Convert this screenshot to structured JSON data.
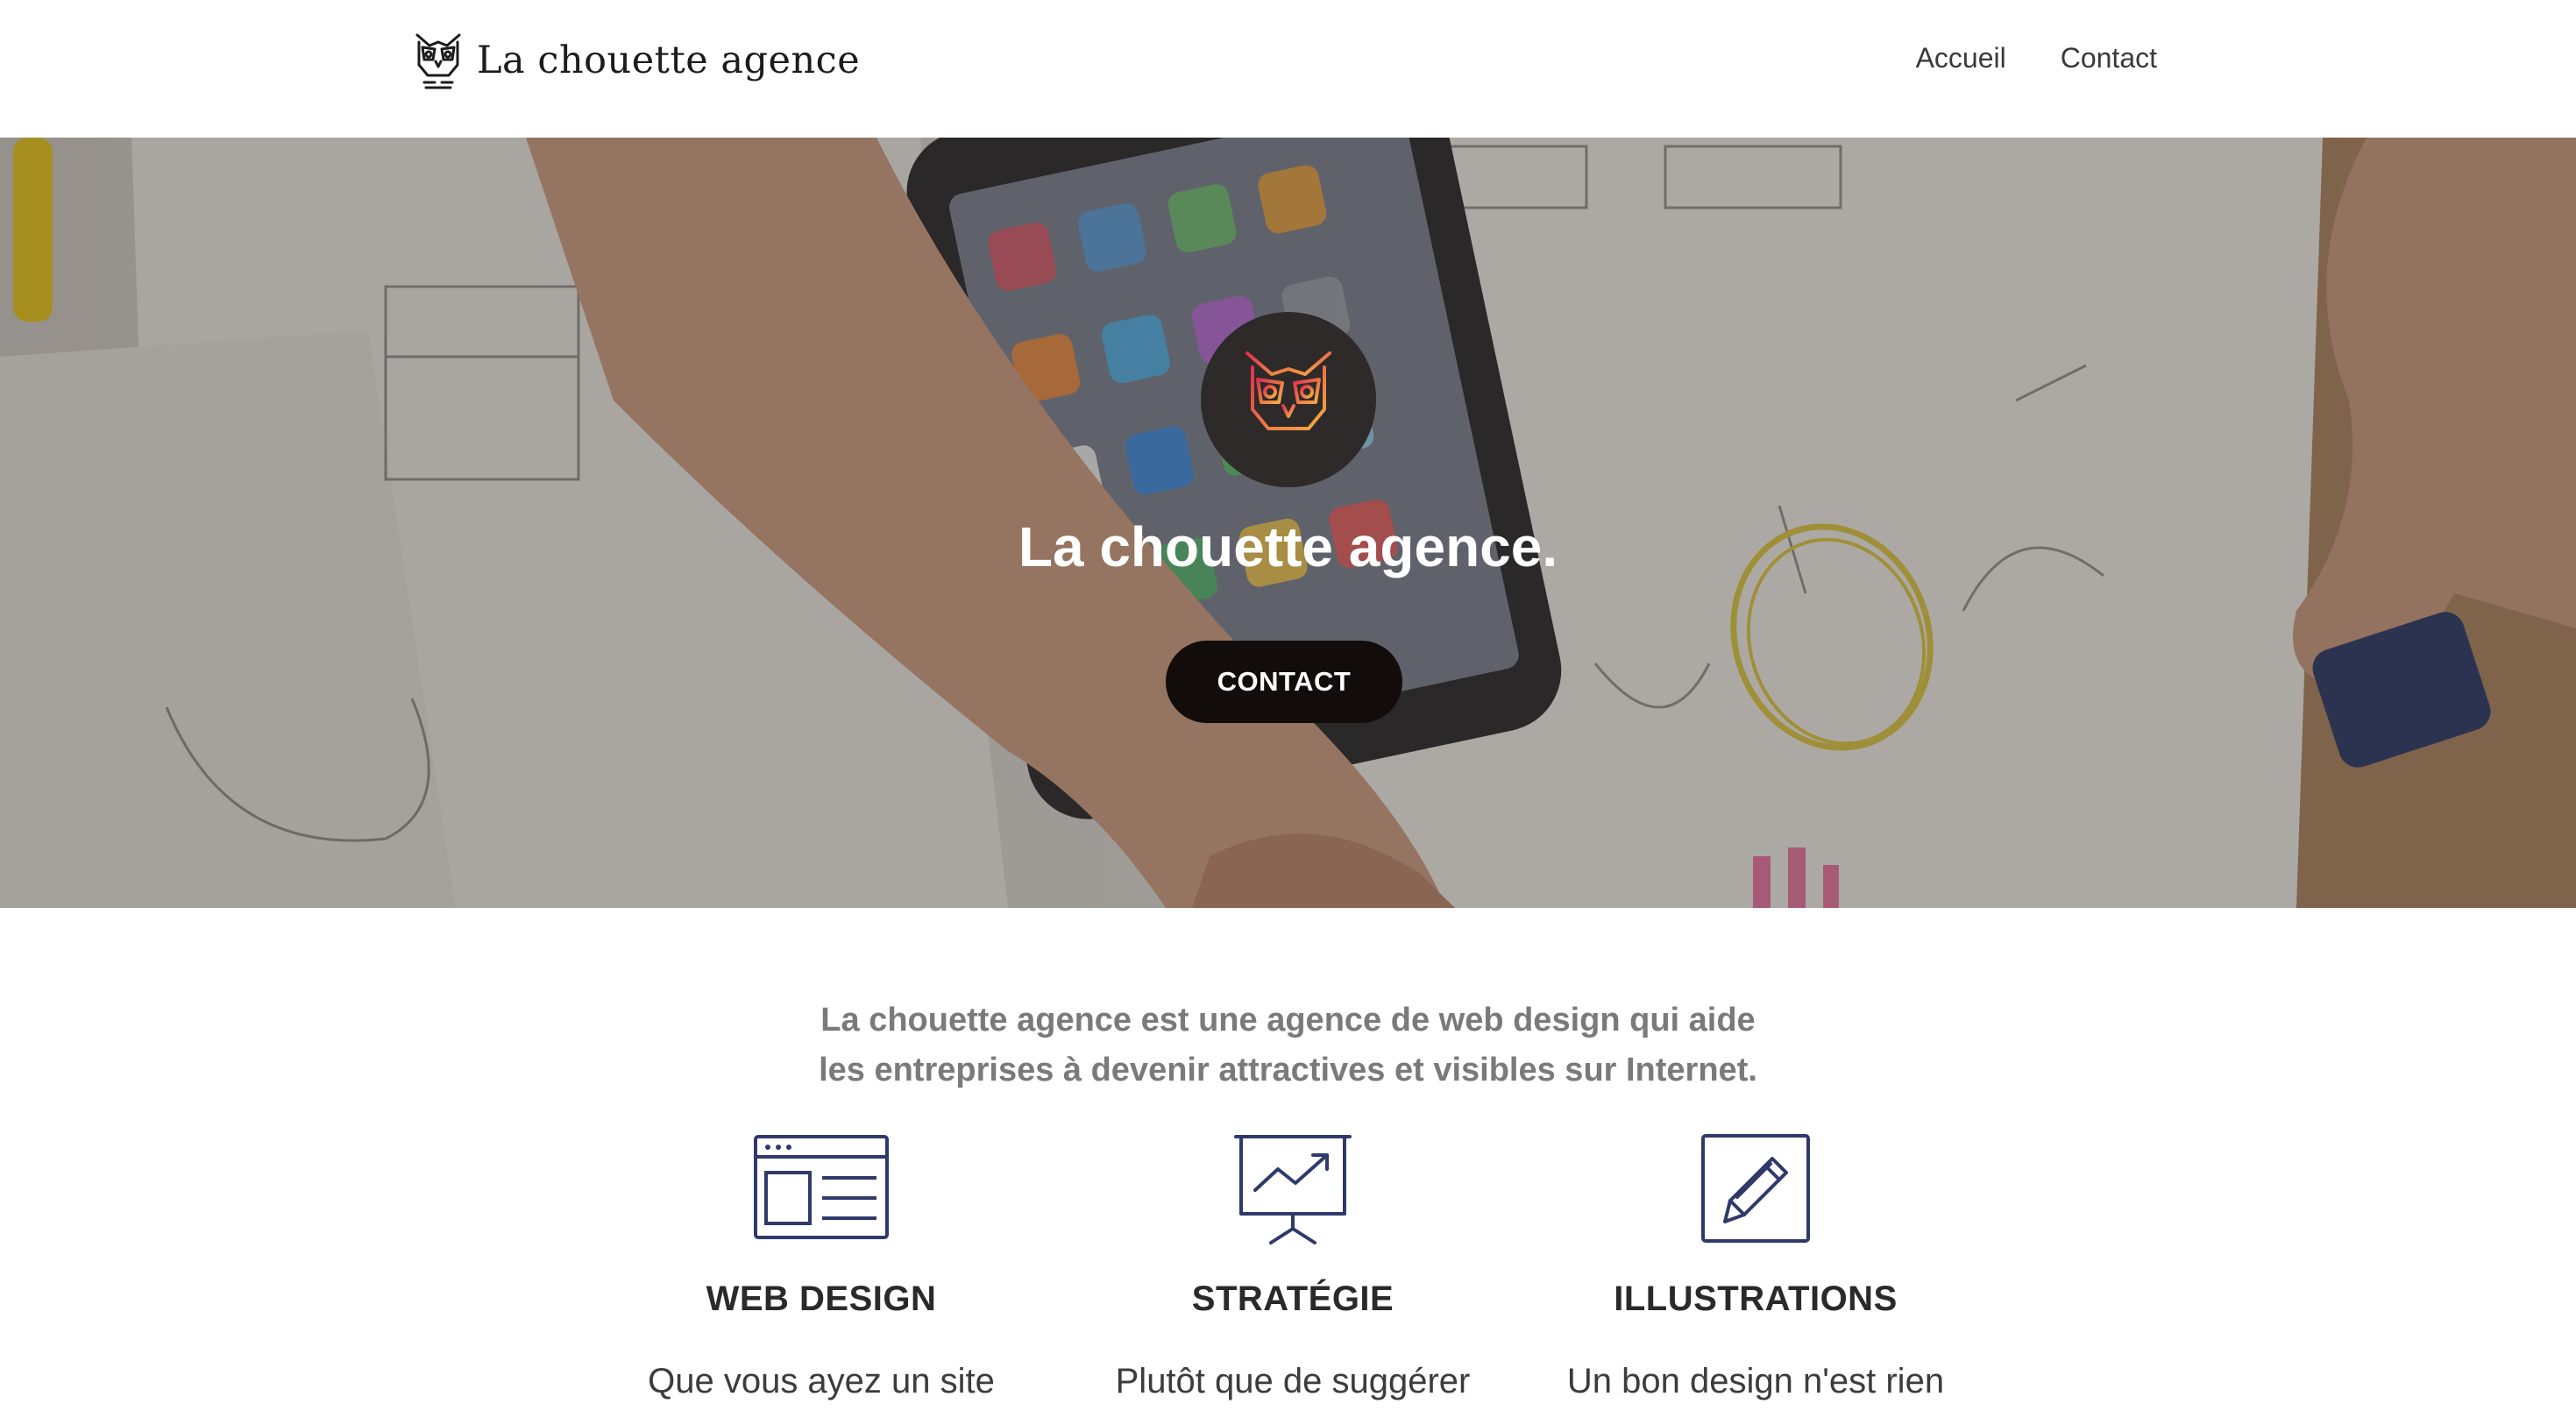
{
  "header": {
    "brand_name": "La chouette agence",
    "nav": [
      {
        "label": "Accueil"
      },
      {
        "label": "Contact"
      }
    ]
  },
  "hero": {
    "title": "La chouette agence.",
    "cta_label": "CONTACT",
    "badge_icon": "owl-icon",
    "hero_image": "desk-with-phone-and-wireframe-sketches"
  },
  "intro": {
    "line1": "La chouette agence est une agence de web design qui aide",
    "line2": "les entreprises à devenir attractives et visibles sur Internet."
  },
  "services": [
    {
      "icon": "browser-window-icon",
      "title": "WEB DESIGN",
      "text": "Que vous ayez un site"
    },
    {
      "icon": "presentation-chart-icon",
      "title": "STRATÉGIE",
      "text": "Plutôt que de suggérer"
    },
    {
      "icon": "pencil-square-icon",
      "title": "ILLUSTRATIONS",
      "text": "Un bon design n'est rien"
    }
  ],
  "colors": {
    "accent_icon": "#2f3a6b",
    "cta_background": "#120d0b",
    "owl_gradient_start": "#e0314e",
    "owl_gradient_end": "#f5b041",
    "intro_text": "#7a7a7a"
  }
}
